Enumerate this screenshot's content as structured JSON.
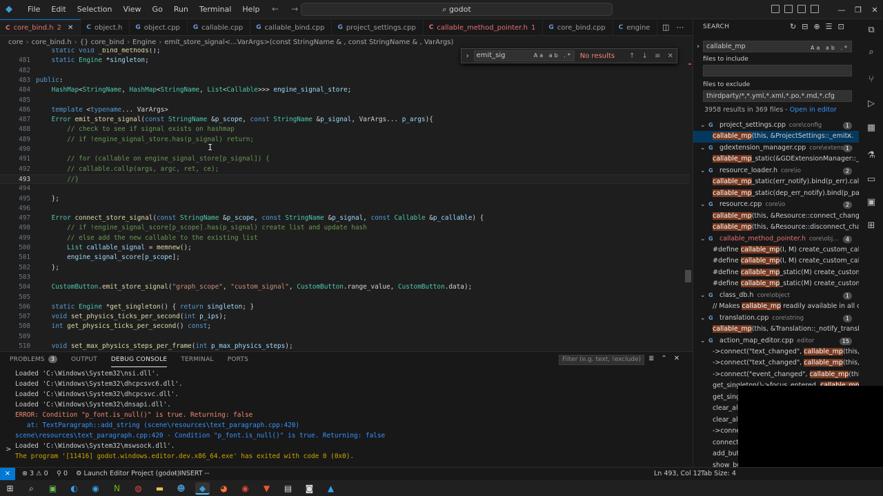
{
  "titlebar": {
    "menus": [
      "File",
      "Edit",
      "Selection",
      "View",
      "Go",
      "Run",
      "Terminal",
      "Help"
    ],
    "command_center": "godot"
  },
  "tabs": [
    {
      "label": "core_bind.h",
      "suffix": "2",
      "icon": "C",
      "active": true,
      "modified": true
    },
    {
      "label": "object.h",
      "icon": "C",
      "active": false,
      "modified": false
    },
    {
      "label": "object.cpp",
      "icon": "G",
      "active": false,
      "modified": false
    },
    {
      "label": "callable.cpp",
      "icon": "G",
      "active": false,
      "modified": false
    },
    {
      "label": "callable_bind.cpp",
      "icon": "G",
      "active": false,
      "modified": false
    },
    {
      "label": "project_settings.cpp",
      "icon": "G",
      "active": false,
      "modified": false
    },
    {
      "label": "callable_method_pointer.h",
      "suffix": "1",
      "icon": "C",
      "active": false,
      "modified": true
    },
    {
      "label": "core_bind.cpp",
      "icon": "G",
      "active": false,
      "modified": false
    },
    {
      "label": "engine",
      "icon": "C",
      "active": false,
      "modified": false
    }
  ],
  "breadcrumbs": [
    "core",
    "core_bind.h",
    "{} core_bind",
    "Engine",
    "emit_store_signal<...VarArgs>(const StringName & , const StringName & , VarArgs)"
  ],
  "find_widget": {
    "query": "emit_sig",
    "options": "Aa ab .*",
    "result": "No results"
  },
  "code": [
    {
      "n": "",
      "t": "    static void _bind_methods();"
    },
    {
      "n": "481",
      "t": "    static Engine *singleton;"
    },
    {
      "n": "482",
      "t": ""
    },
    {
      "n": "483",
      "t": "public:"
    },
    {
      "n": "484",
      "t": "    HashMap<StringName, HashMap<StringName, List<Callable>>> engine_signal_store;"
    },
    {
      "n": "485",
      "t": ""
    },
    {
      "n": "486",
      "t": "    template <typename... VarArgs>"
    },
    {
      "n": "487",
      "t": "    Error emit_store_signal(const StringName &p_scope, const StringName &p_signal, VarArgs... p_args){"
    },
    {
      "n": "488",
      "t": "        // check to see if signal exists on hashmap"
    },
    {
      "n": "489",
      "t": "        // if !engine_signal_store.has(p_signal) return;"
    },
    {
      "n": "490",
      "t": ""
    },
    {
      "n": "491",
      "t": "        // for (callable on engine_signal_store[p_signal]) {"
    },
    {
      "n": "492",
      "t": "        // callable.callp(args, argc, ret, ce);"
    },
    {
      "n": "493",
      "t": "        //}"
    },
    {
      "n": "494",
      "t": ""
    },
    {
      "n": "495",
      "t": "    };"
    },
    {
      "n": "496",
      "t": ""
    },
    {
      "n": "497",
      "t": "    Error connect_store_signal(const StringName &p_scope, const StringName &p_signal, const Callable &p_callable) {"
    },
    {
      "n": "498",
      "t": "        // if !engine_signal_score[p_scope].has(p_signal) create list and update hash"
    },
    {
      "n": "499",
      "t": "        // else add the new callable to the existing list"
    },
    {
      "n": "500",
      "t": "        List callable_signal = memnew();"
    },
    {
      "n": "501",
      "t": "        engine_signal_score[p_scope];"
    },
    {
      "n": "502",
      "t": "    };"
    },
    {
      "n": "503",
      "t": ""
    },
    {
      "n": "504",
      "t": "    CustomButton.emit_store_signal(\"graph_scope\", \"custom_signal\", CustomButton.range_value, CustomButton.data);"
    },
    {
      "n": "505",
      "t": ""
    },
    {
      "n": "506",
      "t": "    static Engine *get_singleton() { return singleton; }"
    },
    {
      "n": "507",
      "t": "    void set_physics_ticks_per_second(int p_ips);"
    },
    {
      "n": "508",
      "t": "    int get_physics_ticks_per_second() const;"
    },
    {
      "n": "509",
      "t": ""
    },
    {
      "n": "510",
      "t": "    void set_max_physics_steps_per_frame(int p_max_physics_steps);"
    }
  ],
  "panel": {
    "tabs": [
      "PROBLEMS",
      "OUTPUT",
      "DEBUG CONSOLE",
      "TERMINAL",
      "PORTS"
    ],
    "problems_count": "3",
    "active_tab": "DEBUG CONSOLE",
    "filter_placeholder": "Filter (e.g. text, !exclude)",
    "console": [
      {
        "kind": "normal",
        "text": "Loaded 'C:\\Windows\\System32\\nsi.dll'."
      },
      {
        "kind": "normal",
        "text": "Loaded 'C:\\Windows\\System32\\dhcpcsvc6.dll'."
      },
      {
        "kind": "normal",
        "text": "Loaded 'C:\\Windows\\System32\\dhcpcsvc.dll'."
      },
      {
        "kind": "normal",
        "text": "Loaded 'C:\\Windows\\System32\\dnsapi.dll'."
      },
      {
        "kind": "err",
        "text": "ERROR: Condition \"p_font.is_null()\" is true. Returning: false"
      },
      {
        "kind": "link",
        "text": "   at: TextParagraph::add_string (scene\\resources\\text_paragraph.cpp:420)"
      },
      {
        "kind": "link",
        "text": "scene\\resources\\text_paragraph.cpp:420 - Condition \"p_font.is_null()\" is true. Returning: false"
      },
      {
        "kind": "normal",
        "text": "Loaded 'C:\\Windows\\System32\\mswsock.dll'."
      },
      {
        "kind": "warn",
        "text": "The program '[11416] godot.windows.editor.dev.x86_64.exe' has exited with code 0 (0x0)."
      }
    ],
    "prompt": ">"
  },
  "search": {
    "title": "SEARCH",
    "query": "callable_mp",
    "query_options": "Aa ab .*",
    "include_label": "files to include",
    "include_value": "",
    "exclude_label": "files to exclude",
    "exclude_value": "thirdparty/*,*.yml,*.xml,*.po,*.md,*.cfg",
    "summary": "3958 results in 369 files -",
    "open_editor": "Open in editor",
    "results": [
      {
        "type": "file",
        "name": "project_settings.cpp",
        "path": "core\\config",
        "count": "1",
        "modified": false
      },
      {
        "type": "match",
        "pre": "",
        "hl": "callable_mp",
        "post": "(this, &ProjectSettings::_emit...",
        "selected": true
      },
      {
        "type": "file",
        "name": "gdextension_manager.cpp",
        "path": "core\\extension",
        "count": "1",
        "modified": false
      },
      {
        "type": "match",
        "pre": "",
        "hl": "callable_mp",
        "post": "_static(&GDExtensionManager::_rel...",
        "selected": false
      },
      {
        "type": "file",
        "name": "resource_loader.h",
        "path": "core\\io",
        "count": "2",
        "modified": false
      },
      {
        "type": "match",
        "pre": "",
        "hl": "callable_mp",
        "post": "_static(err_notify).bind(p_err).call_de...",
        "selected": false
      },
      {
        "type": "match",
        "pre": "",
        "hl": "callable_mp",
        "post": "_static(dep_err_notify).bind(p_path, ...",
        "selected": false
      },
      {
        "type": "file",
        "name": "resource.cpp",
        "path": "core\\io",
        "count": "2",
        "modified": false
      },
      {
        "type": "match",
        "pre": "",
        "hl": "callable_mp",
        "post": "(this, &Resource::connect_changed)...",
        "selected": false
      },
      {
        "type": "match",
        "pre": "",
        "hl": "callable_mp",
        "post": "(this, &Resource::disconnect_chang...",
        "selected": false
      },
      {
        "type": "file",
        "name": "callable_method_pointer.h",
        "path": "core\\obj...",
        "count": "4",
        "modified": true,
        "suffix": "1"
      },
      {
        "type": "match",
        "pre": "#define ",
        "hl": "callable_mp",
        "post": "(I, M) create_custom_callabl...",
        "selected": false
      },
      {
        "type": "match",
        "pre": "#define ",
        "hl": "callable_mp",
        "post": "(I, M) create_custom_callabl...",
        "selected": false
      },
      {
        "type": "match",
        "pre": "#define ",
        "hl": "callable_mp",
        "post": "_static(M) create_custom_c...",
        "selected": false
      },
      {
        "type": "match",
        "pre": "#define ",
        "hl": "callable_mp",
        "post": "_static(M) create_custom_c...",
        "selected": false
      },
      {
        "type": "file",
        "name": "class_db.h",
        "path": "core\\object",
        "count": "1",
        "modified": false
      },
      {
        "type": "match",
        "pre": "// Makes ",
        "hl": "callable_mp",
        "post": " readily available in all clas...",
        "selected": false
      },
      {
        "type": "file",
        "name": "translation.cpp",
        "path": "core\\string",
        "count": "1",
        "modified": false
      },
      {
        "type": "match",
        "pre": "",
        "hl": "callable_mp",
        "post": "(this, &Translation::_notify_translatio...",
        "selected": false
      },
      {
        "type": "file",
        "name": "action_map_editor.cpp",
        "path": "editor",
        "count": "15",
        "modified": false
      },
      {
        "type": "match",
        "pre": "->connect(\"text_changed\", ",
        "hl": "callable_mp",
        "post": "(this, &A...",
        "selected": false
      },
      {
        "type": "match",
        "pre": "->connect(\"text_changed\", ",
        "hl": "callable_mp",
        "post": "(this, &A...",
        "selected": false
      },
      {
        "type": "match",
        "pre": "->connect(\"event_changed\", ",
        "hl": "callable_mp",
        "post": "(this, ...",
        "selected": false
      },
      {
        "type": "match",
        "pre": "get_singleton()->focus_entered, ",
        "hl": "callable_mp",
        "post": "...",
        "selected": false
      },
      {
        "type": "match",
        "pre": "get_singl",
        "hl": "",
        "post": "",
        "selected": false
      },
      {
        "type": "match",
        "pre": "clear_all_",
        "hl": "",
        "post": "",
        "selected": false
      },
      {
        "type": "match",
        "pre": "clear_all_",
        "hl": "",
        "post": "",
        "selected": false
      },
      {
        "type": "match",
        "pre": "->conne",
        "hl": "",
        "post": "",
        "selected": false
      },
      {
        "type": "match",
        "pre": "connect(",
        "hl": "",
        "post": "",
        "selected": false
      },
      {
        "type": "match",
        "pre": "add_butt",
        "hl": "",
        "post": "",
        "selected": false
      },
      {
        "type": "match",
        "pre": "show_bu",
        "hl": "",
        "post": "",
        "selected": false
      }
    ]
  },
  "statusbar": {
    "errors": "3",
    "warnings": "0",
    "ports": "0",
    "launch": "Launch Editor Project (godot)",
    "mode": "-- INSERT --",
    "cursor": "Ln 493, Col 12",
    "tabsize": "Tab Size: 4"
  },
  "colors": {
    "accent": "#0078d4",
    "error": "#f48771",
    "match_highlight": "#7a3b21"
  }
}
